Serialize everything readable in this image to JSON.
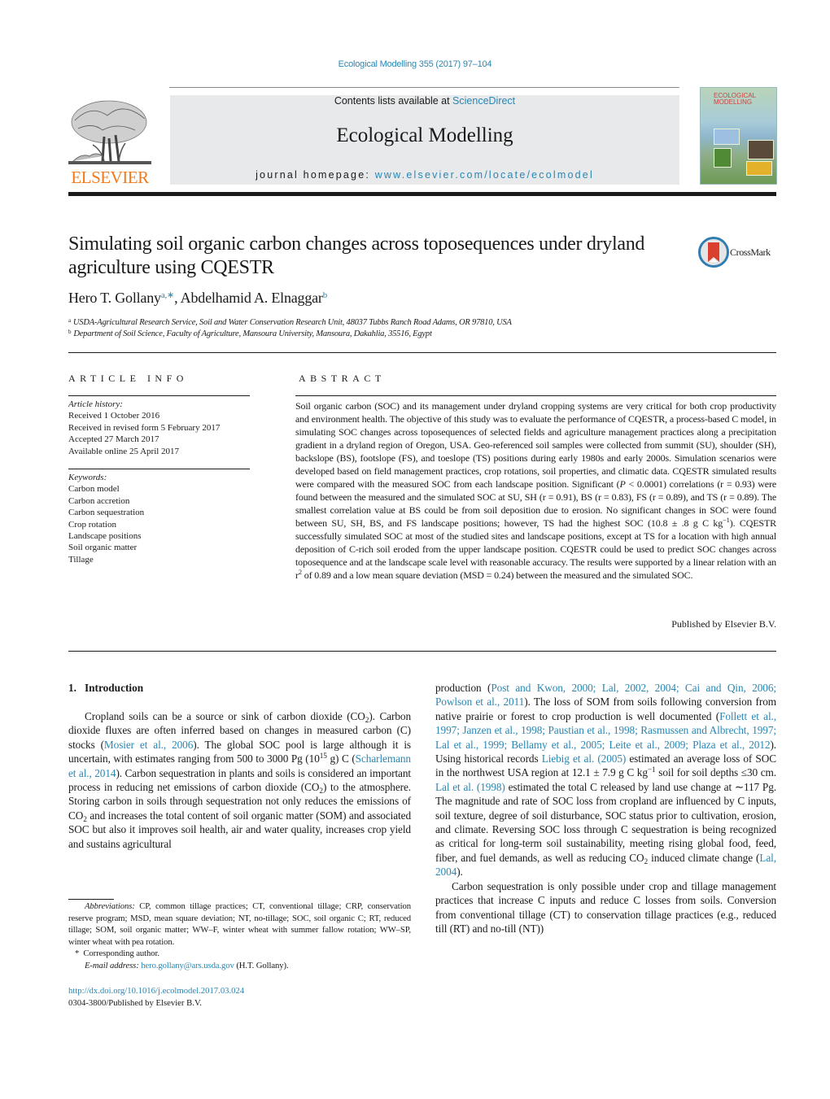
{
  "header": {
    "citation": "Ecological Modelling 355 (2017) 97–104",
    "publisher_logo_text": "ELSEVIER",
    "contents_prefix": "Contents lists available at ",
    "contents_link": "ScienceDirect",
    "journal_name": "Ecological Modelling",
    "homepage_prefix": "journal homepage: ",
    "homepage_link": "www.elsevier.com/locate/ecolmodel",
    "cover_title_line1": "ECOLOGICAL",
    "cover_title_line2": "MODELLING",
    "brand_color": "#f07a1e",
    "link_color": "#2a86b3"
  },
  "article": {
    "title": "Simulating soil organic carbon changes across toposequences under dryland agriculture using CQESTR",
    "crossmark_label": "CrossMark",
    "authors": [
      {
        "name": "Hero T. Gollany",
        "sup": "a,∗"
      },
      {
        "name": "Abdelhamid A. Elnaggar",
        "sup": "b"
      }
    ],
    "affiliations": [
      {
        "mark": "a",
        "text": "USDA-Agricultural Research Service, Soil and Water Conservation Research Unit, 48037 Tubbs Ranch Road Adams, OR 97810, USA"
      },
      {
        "mark": "b",
        "text": "Department of Soil Science, Faculty of Agriculture, Mansoura University, Mansoura, Dakahlia, 35516, Egypt"
      }
    ]
  },
  "article_info": {
    "heading": "ARTICLE INFO",
    "history_label": "Article history:",
    "history": [
      "Received 1 October 2016",
      "Received in revised form 5 February 2017",
      "Accepted 27 March 2017",
      "Available online 25 April 2017"
    ],
    "keywords_label": "Keywords:",
    "keywords": [
      "Carbon model",
      "Carbon accretion",
      "Carbon sequestration",
      "Crop rotation",
      "Landscape positions",
      "Soil organic matter",
      "Tillage"
    ]
  },
  "abstract": {
    "heading": "ABSTRACT",
    "text_part1": "Soil organic carbon (SOC) and its management under dryland cropping systems are very critical for both crop productivity and environment health. The objective of this study was to evaluate the performance of CQESTR, a process-based C model, in simulating SOC changes across toposequences of selected fields and agriculture management practices along a precipitation gradient in a dryland region of Oregon, USA. Geo-referenced soil samples were collected from summit (SU), shoulder (SH), backslope (BS), footslope (FS), and toeslope (TS) positions during early 1980s and early 2000s. Simulation scenarios were developed based on field management practices, crop rotations, soil properties, and climatic data. CQESTR simulated results were compared with the measured SOC from each landscape position. Significant (",
    "p_symbol": "P",
    "text_part2": " < 0.0001) correlations (r = 0.93) were found between the measured and the simulated SOC at SU, SH (r = 0.91), BS (r = 0.83), FS (r = 0.89), and TS (r = 0.89). The smallest correlation value at BS could be from soil deposition due to erosion. No significant changes in SOC were found between SU, SH, BS, and FS landscape positions; however, TS had the highest SOC (10.8 ± .8 g C kg",
    "exp_minus1": "−1",
    "text_part3": "). CQESTR successfully simulated SOC at most of the studied sites and landscape positions, except at TS for a location with high annual deposition of C-rich soil eroded from the upper landscape position. CQESTR could be used to predict SOC changes across toposequence and at the landscape scale level with reasonable accuracy. The results were supported by a linear relation with an r",
    "exp_2": "2",
    "text_part4": " of 0.89 and a low mean square deviation (MSD = 0.24) between the measured and the simulated SOC.",
    "published_by": "Published by Elsevier B.V."
  },
  "introduction": {
    "number": "1.",
    "heading": "Introduction",
    "left": {
      "s1": "Cropland soils can be a source or sink of carbon dioxide (CO",
      "sub2": "2",
      "s2": "). Carbon dioxide fluxes are often inferred based on changes in measured carbon (C) stocks (",
      "ref1": "Mosier et al., 2006",
      "s3": "). The global SOC pool is large although it is uncertain, with estimates ranging from 500 to 3000 Pg (10",
      "exp15": "15",
      "s4": " g) C (",
      "ref2": "Scharlemann et al., 2014",
      "s5": "). Carbon sequestration in plants and soils is considered an important process in reducing net emissions of carbon dioxide (CO",
      "s6": ") to the atmosphere. Storing carbon in soils through sequestration not only reduces the emissions of CO",
      "s7": " and increases the total content of soil organic matter (SOM) and associated SOC but also it improves soil health, air and water quality, increases crop yield and sustains agricultural"
    },
    "right": {
      "r1": "production (",
      "ref3": "Post and Kwon, 2000; Lal, 2002, 2004; Cai and Qin, 2006; Powlson et al., 2011",
      "r2": "). The loss of SOM from soils following conversion from native prairie or forest to crop production is well documented (",
      "ref4": "Follett et al., 1997; Janzen et al., 1998; Paustian et al., 1998; Rasmussen and Albrecht, 1997; Lal et al., 1999; Bellamy et al., 2005; Leite et al., 2009; Plaza et al., 2012",
      "r3": "). Using historical records ",
      "ref5": "Liebig et al. (2005)",
      "r4": " estimated an average loss of SOC in the northwest USA region at 12.1 ± 7.9 g C kg",
      "exp_minus1": "−1",
      "r5": " soil for soil depths ≤30 cm. ",
      "ref6": "Lal et al. (1998)",
      "r6": " estimated the total C released by land use change at ∼117 Pg. The magnitude and rate of SOC loss from cropland are influenced by C inputs, soil texture, degree of soil disturbance, SOC status prior to cultivation, erosion, and climate. Reversing SOC loss through C sequestration is being recognized as critical for long-term soil sustainability, meeting rising global food, feed, fiber, and fuel demands, as well as reducing CO",
      "r7": " induced climate change (",
      "ref7": "Lal, 2004",
      "r8": ").",
      "p2": "Carbon sequestration is only possible under crop and tillage management practices that increase C inputs and reduce C losses from soils. Conversion from conventional tillage (CT) to conservation tillage practices (e.g., reduced till (RT) and no-till (NT))"
    }
  },
  "footnotes": {
    "abbrev_label": "Abbreviations:",
    "abbrev_text": " CP, common tillage practices; CT, conventional tillage; CRP, conservation reserve program; MSD, mean square deviation; NT, no-tillage; SOC, soil organic C; RT, reduced tillage; SOM, soil organic matter; WW–F, winter wheat with summer fallow rotation; WW–SP, winter wheat with pea rotation.",
    "corresponding_mark": "*",
    "corresponding": "Corresponding author.",
    "email_label": "E-mail address:",
    "email": "hero.gollany@ars.usda.gov",
    "email_suffix": " (H.T. Gollany).",
    "doi": "http://dx.doi.org/10.1016/j.ecolmodel.2017.03.024",
    "issn_line": "0304-3800/Published by Elsevier B.V."
  }
}
